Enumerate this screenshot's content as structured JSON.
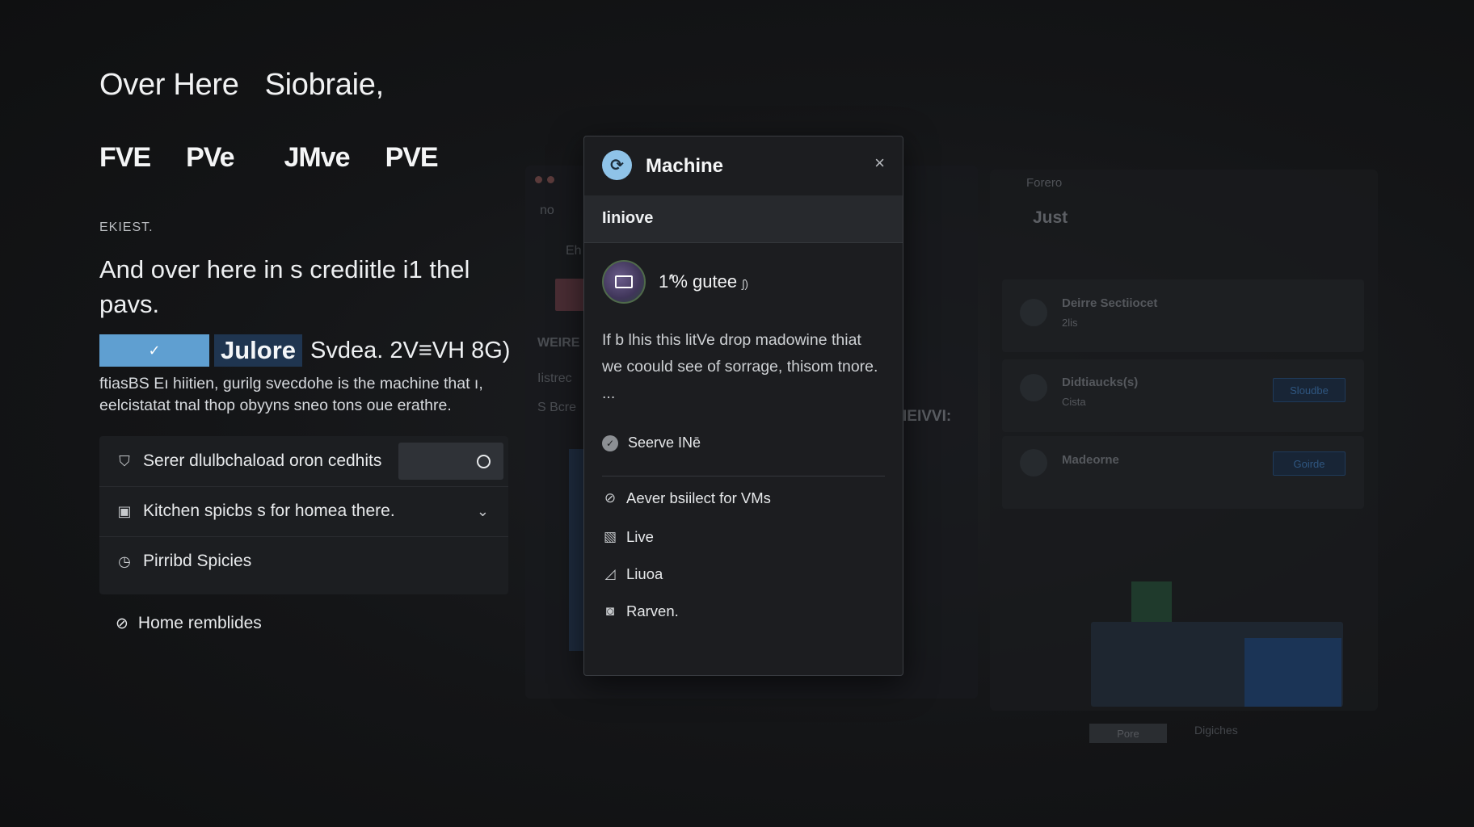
{
  "hero": {
    "title_1": "Over Here",
    "title_2": "Siobraie,"
  },
  "tabs": [
    "FVE",
    "PVe",
    "JMve",
    "PVE"
  ],
  "eyebrow": "EKIEST.",
  "headline": "And over here in s crediitle i1 thel pavs.",
  "selector": {
    "check_glyph": "✓",
    "chip_label": "Julore",
    "tail_text": "Svdea. 2V≡VH 8G)"
  },
  "description": "ftiasBS Eı hiitien, gurilg svecdohe is the machine that ı, eelcistatat tnal thop obyyns sneo tons oue erathre.",
  "options": {
    "items": [
      {
        "icon": "shield-icon",
        "glyph": "⛉",
        "label": "Serer dlulbchaload oron cedhits",
        "control": "toggle"
      },
      {
        "icon": "monitor-icon",
        "glyph": "▣",
        "label": "Kitchen spicbs s for    homea there.",
        "control": "chevron"
      },
      {
        "icon": "clock-icon",
        "glyph": "◷",
        "label": "Pirribd Spicies",
        "control": "none"
      }
    ],
    "chevron_glyph": "⌄"
  },
  "home_item": {
    "glyph": "⊘",
    "label": "Home remblides"
  },
  "background": {
    "left_window": {
      "tab_label": "no",
      "row_label": "Eh",
      "section_label": "WEIRE",
      "line_1": "Iistrec",
      "line_2": "S Bcre"
    },
    "mid_label": "IEIVVI:",
    "right_window": {
      "title": "Forero",
      "heading": "Just",
      "cards": [
        {
          "name": "Deirre Sectiiocet",
          "sub": "2lis",
          "button": ""
        },
        {
          "name": "Didtiaucks(s)",
          "sub": "Cista",
          "button": "Sloudbe"
        },
        {
          "name": "Madeorne",
          "sub": "",
          "button": "Goirde"
        }
      ]
    },
    "footer": {
      "button": "Pore",
      "link": "Digiches"
    }
  },
  "modal": {
    "logo_glyph": "⟳",
    "title": "Machine",
    "close_glyph": "×",
    "subheader": "Iiniove",
    "status_main": "1′̓% gutee",
    "status_suffix": "ʃ)",
    "body": "If b lhis this litVe drop madowine thiat we coould see of sorrage, thisom tnore. ...",
    "serve": {
      "glyph": "✓",
      "label": "Seerve INē"
    },
    "list": [
      {
        "icon": "circle-check-icon",
        "glyph": "⊘",
        "label": "Aever bsiilect for VMs"
      },
      {
        "icon": "image-icon",
        "glyph": "▧",
        "label": "Live"
      },
      {
        "icon": "edit-icon",
        "glyph": "◿",
        "label": "Liuoa"
      },
      {
        "icon": "camera-icon",
        "glyph": "◙",
        "label": "Rarven."
      }
    ]
  }
}
